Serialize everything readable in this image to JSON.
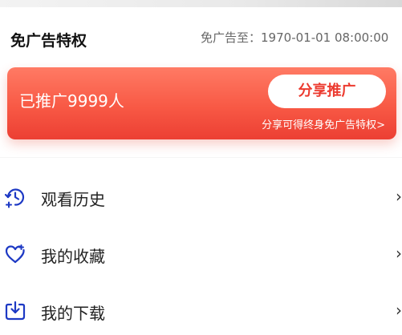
{
  "vip": {
    "title": "免广告特权",
    "expire_label": "免广告至：",
    "expire_value": "1970-01-01 08:00:00"
  },
  "promo": {
    "count_text": "已推广9999人",
    "share_button": "分享推广",
    "note": "分享可得终身免广告特权>"
  },
  "menu": {
    "items": [
      {
        "label": "观看历史",
        "icon": "history-icon"
      },
      {
        "label": "我的收藏",
        "icon": "heart-icon"
      },
      {
        "label": "我的下载",
        "icon": "download-icon"
      }
    ],
    "chevron": "›"
  },
  "colors": {
    "accent": "#f85945",
    "icon_blue": "#1d39c4"
  }
}
